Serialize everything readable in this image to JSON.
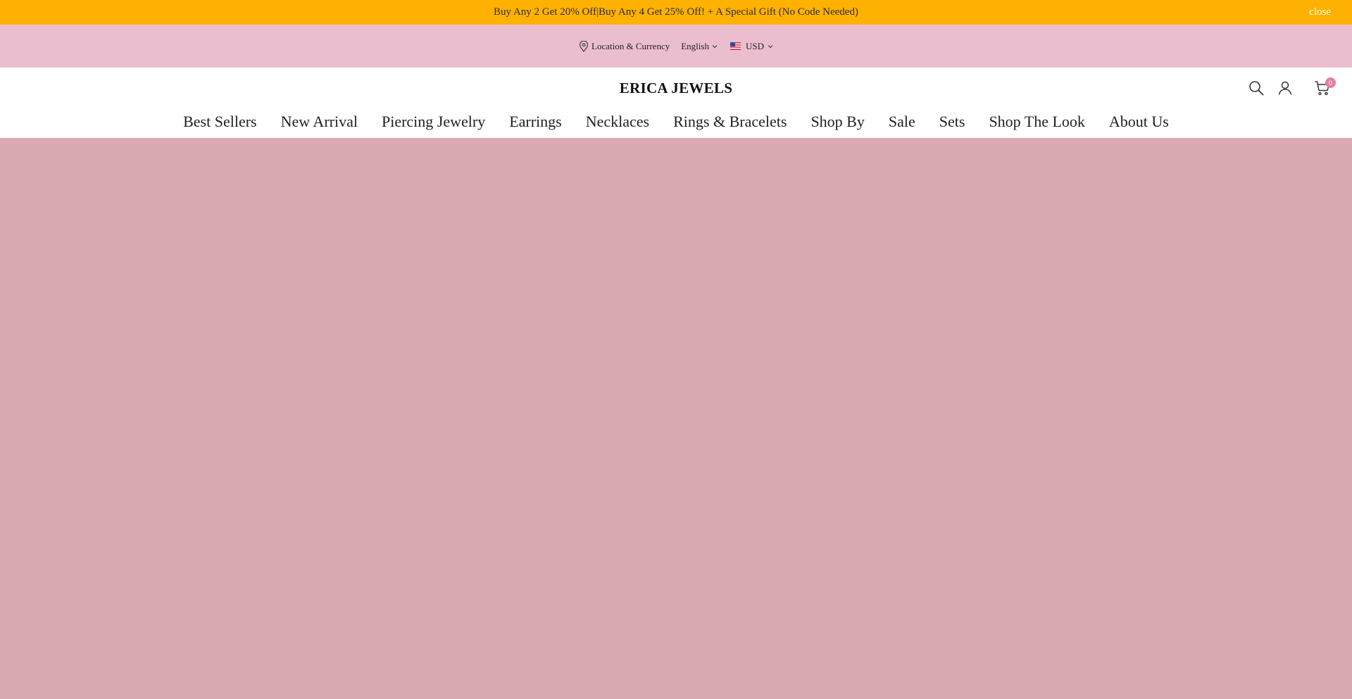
{
  "announcement": {
    "text": "Buy Any 2 Get 20% Off|Buy Any 4 Get 25% Off! + A Special Gift (No Code Needed)",
    "close_label": "close"
  },
  "topbar": {
    "location_label": "Location & Currency",
    "language": "English",
    "currency": "USD",
    "icons": {
      "location": "map-pin-icon",
      "flag": "us-flag-icon",
      "chevron": "chevron-down-icon"
    }
  },
  "header": {
    "logo": "ERICA JEWELS",
    "cart_count": "0",
    "icons": {
      "search": "search-icon",
      "account": "user-icon",
      "cart": "cart-icon"
    }
  },
  "nav": {
    "items": [
      "Best Sellers",
      "New Arrival",
      "Piercing Jewelry",
      "Earrings",
      "Necklaces",
      "Rings & Bracelets",
      "Shop By",
      "Sale",
      "Sets",
      "Shop The Look",
      "About Us"
    ]
  },
  "colors": {
    "announcement_bg": "#ffb100",
    "topbar_bg": "#ebbecf",
    "hero_bg": "#dba9b2",
    "badge": "#e37fa0"
  }
}
